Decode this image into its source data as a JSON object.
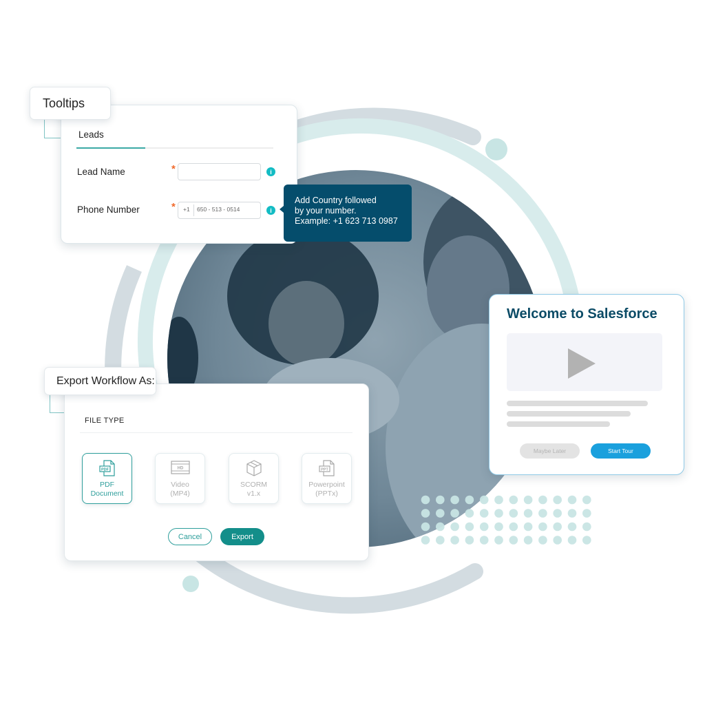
{
  "colors": {
    "ring_grey": "#d3dce1",
    "ring_teal": "#d8ecec",
    "dot_teal": "#c8e5e4",
    "accent_teal": "#2d9e9b",
    "tooltip_bg": "#054d6c",
    "info_icon": "#13bcc4",
    "required": "#f06a2c",
    "start_tour": "#1aa0dd",
    "welcome_title": "#0b4b66"
  },
  "photo": {
    "description": "Two smiling women in a call-center setting, one wearing a headset (duotone blue-grey)"
  },
  "tooltips_section": {
    "chip_label": "Tooltips",
    "tab_label": "Leads",
    "fields": [
      {
        "label": "Lead Name",
        "required_mark": "*",
        "value": "",
        "info_icon": "i"
      },
      {
        "label": "Phone Number",
        "required_mark": "*",
        "country_code": "+1",
        "value": "650 - 513 - 0514",
        "info_icon": "i"
      }
    ],
    "tooltip_lines": [
      "Add Country followed",
      "by your number.",
      "Example: +1 623 713 0987"
    ]
  },
  "welcome": {
    "title": "Welcome to Salesforce",
    "maybe_label": "Maybe Later",
    "start_label": "Start Tour"
  },
  "export_section": {
    "chip_label": "Export Workflow As:",
    "section_label": "FILE TYPE",
    "options": [
      {
        "icon": "pdf-file-icon",
        "line1": "PDF",
        "line2": "Document",
        "selected": true
      },
      {
        "icon": "hd-video-icon",
        "line1": "Video",
        "line2": "(MP4)",
        "selected": false
      },
      {
        "icon": "package-box-icon",
        "line1": "SCORM",
        "line2": "v1.x",
        "selected": false
      },
      {
        "icon": "ppt-file-icon",
        "line1": "Powerpoint",
        "line2": "(PPTx)",
        "selected": false
      }
    ],
    "cancel_label": "Cancel",
    "export_label": "Export"
  }
}
